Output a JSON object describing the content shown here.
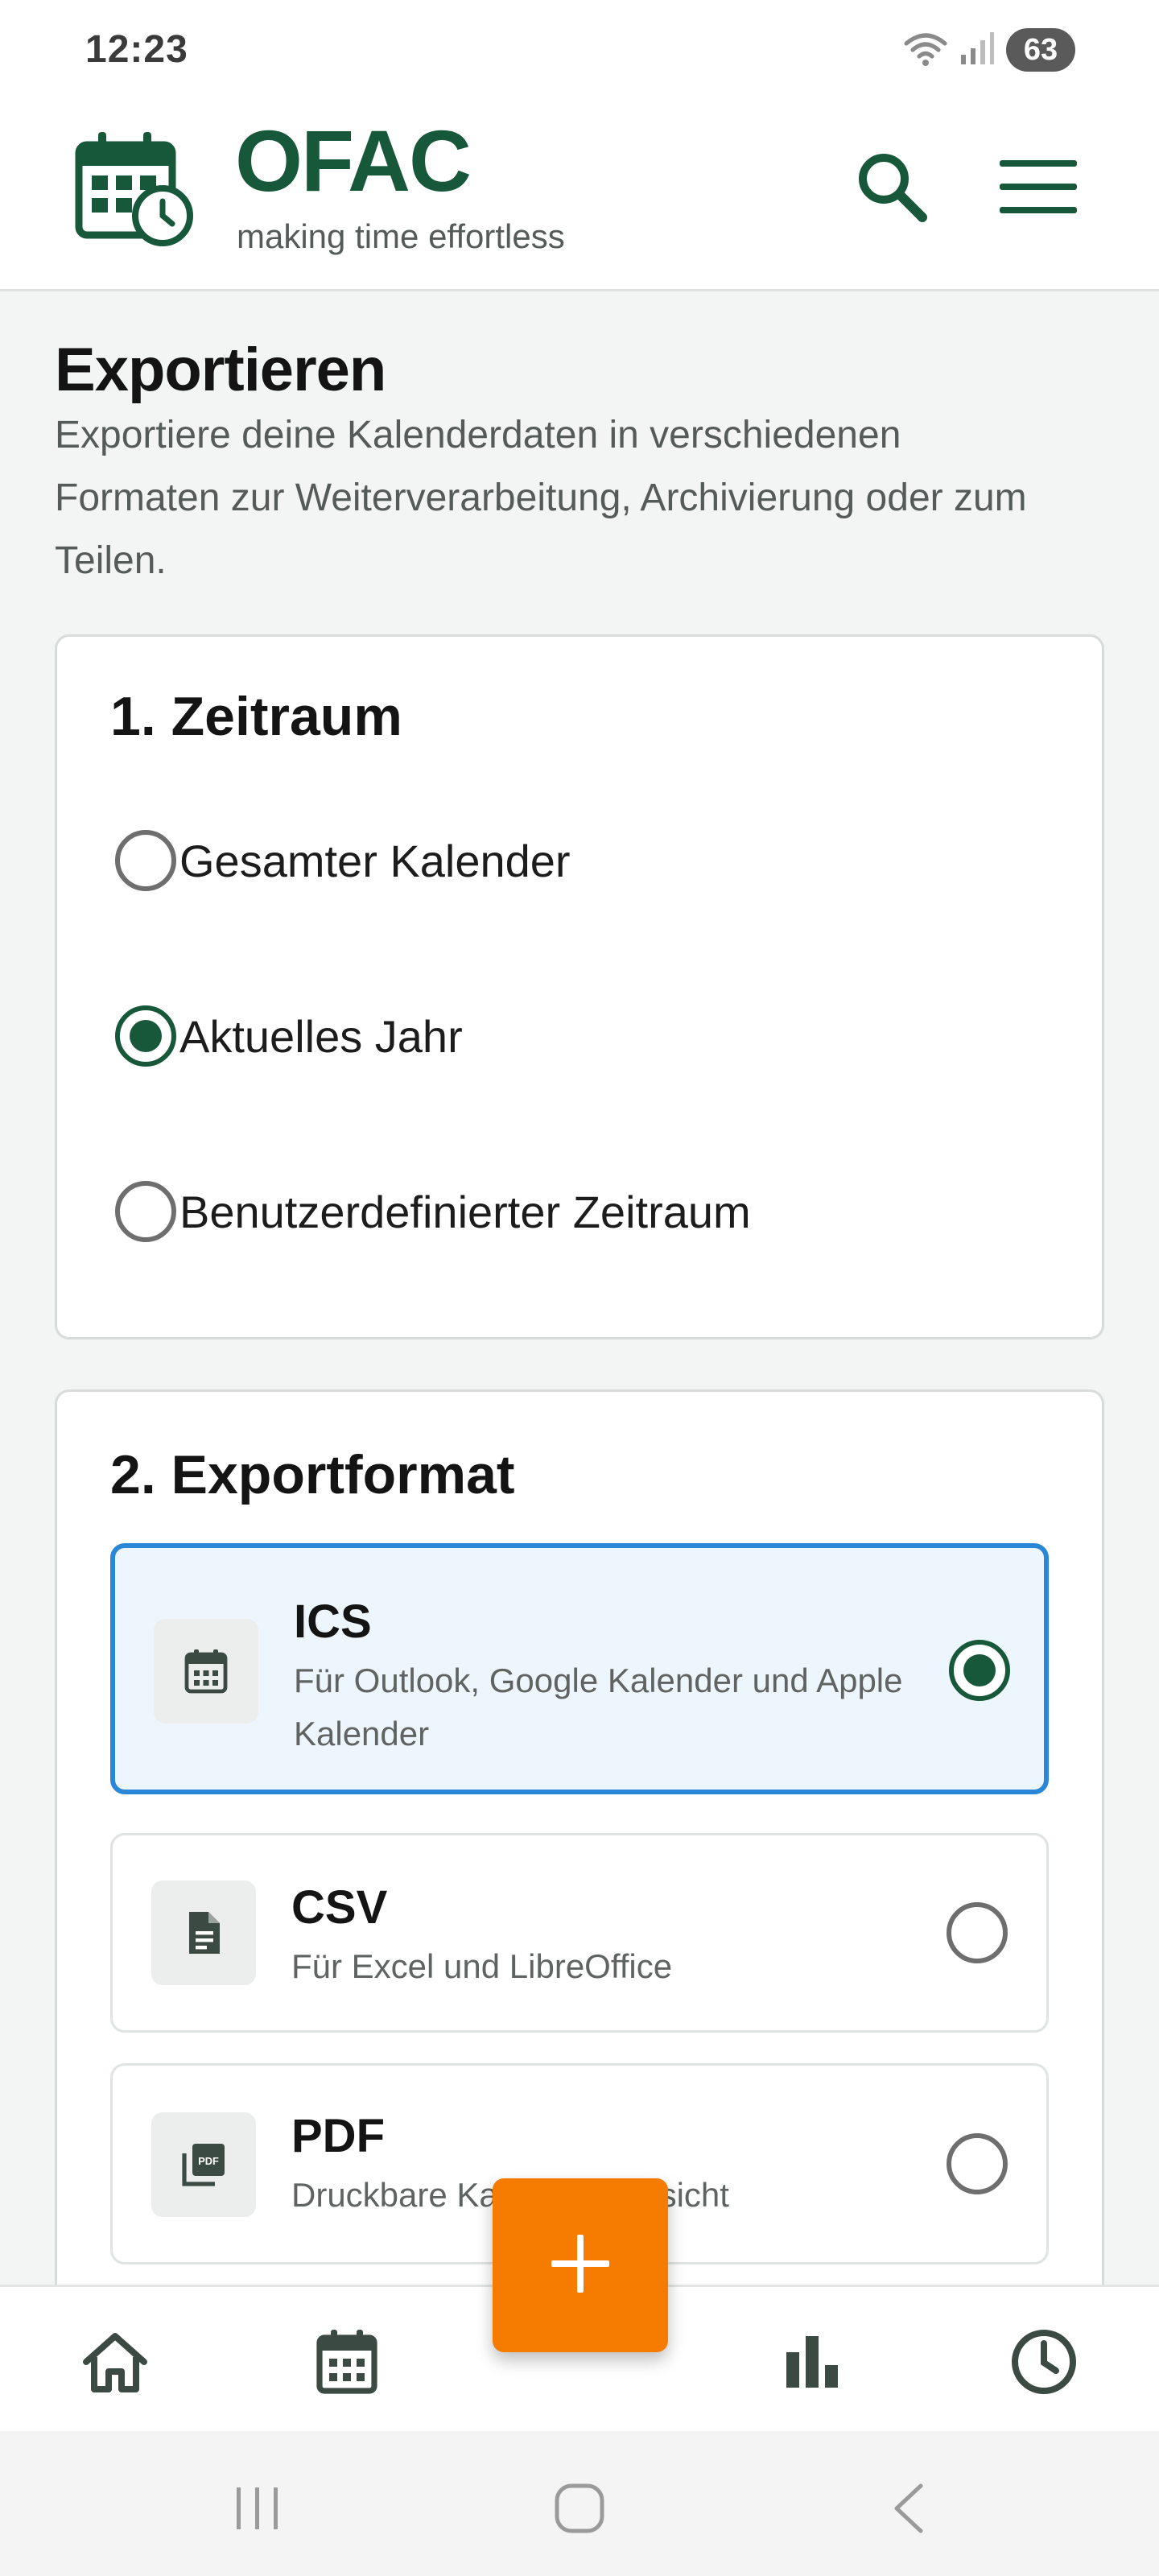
{
  "status_bar": {
    "time": "12:23",
    "battery": "63"
  },
  "header": {
    "brand": "OFAC",
    "tagline": "making time effortless"
  },
  "page": {
    "title": "Exportieren",
    "description": "Exportiere deine Kalenderdaten in verschiedenen Formaten zur Weiterverarbeitung, Archivierung oder zum Teilen."
  },
  "zeitraum": {
    "title": "1. Zeitraum",
    "options": [
      {
        "label": "Gesamter Kalender",
        "selected": false
      },
      {
        "label": "Aktuelles Jahr",
        "selected": true
      },
      {
        "label": "Benutzerdefinierter Zeitraum",
        "selected": false
      }
    ]
  },
  "exportformat": {
    "title": "2. Exportformat",
    "options": [
      {
        "name": "ICS",
        "description": "Für Outlook, Google Kalender und Apple Kalender",
        "selected": true,
        "icon": "calendar-icon"
      },
      {
        "name": "CSV",
        "description": "Für Excel und LibreOffice",
        "selected": false,
        "icon": "document-icon"
      },
      {
        "name": "PDF",
        "description": "Druckbare Kalenderübersicht",
        "selected": false,
        "icon": "pdf-icon"
      }
    ]
  },
  "bottom_nav": {
    "items": [
      {
        "id": "home",
        "icon": "home-icon"
      },
      {
        "id": "calendar",
        "icon": "calendar-icon"
      },
      {
        "id": "statistics",
        "icon": "bar-chart-icon"
      },
      {
        "id": "time",
        "icon": "clock-icon"
      }
    ]
  },
  "colors": {
    "brand": "#17583b",
    "accent": "#f57c00",
    "selected_border": "#2a86d6",
    "selected_bg": "#eef6fd"
  }
}
